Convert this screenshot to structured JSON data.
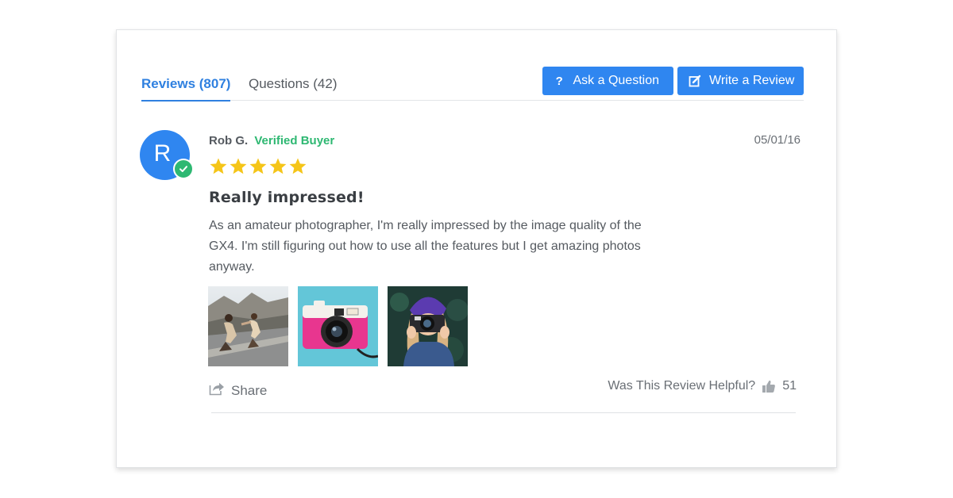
{
  "tabs": [
    {
      "label": "Reviews (807)",
      "active": true
    },
    {
      "label": "Questions (42)",
      "active": false
    }
  ],
  "actions": {
    "ask_label": "Ask a Question",
    "ask_icon": "question-mark-icon",
    "write_label": "Write a Review",
    "write_icon": "edit-icon"
  },
  "review": {
    "avatar_initial": "R",
    "reviewer_name": "Rob G.",
    "badge": "Verified Buyer",
    "date": "05/01/16",
    "rating": 5,
    "rating_max": 5,
    "title": "Really impressed!",
    "body": "As an amateur photographer, I'm really impressed by the image quality of the GX4. I'm still figuring out how to use all the features but I get amazing photos anyway.",
    "photos": [
      "skateboarders-photo",
      "pink-camera-photo",
      "woman-with-camera-photo"
    ],
    "share_label": "Share",
    "helpful_label": "Was This Review Helpful?",
    "helpful_count": "51"
  },
  "colors": {
    "accent": "#2f86f0",
    "tab_active": "#2f80e0",
    "verified": "#2eb872",
    "star": "#f5c518"
  }
}
